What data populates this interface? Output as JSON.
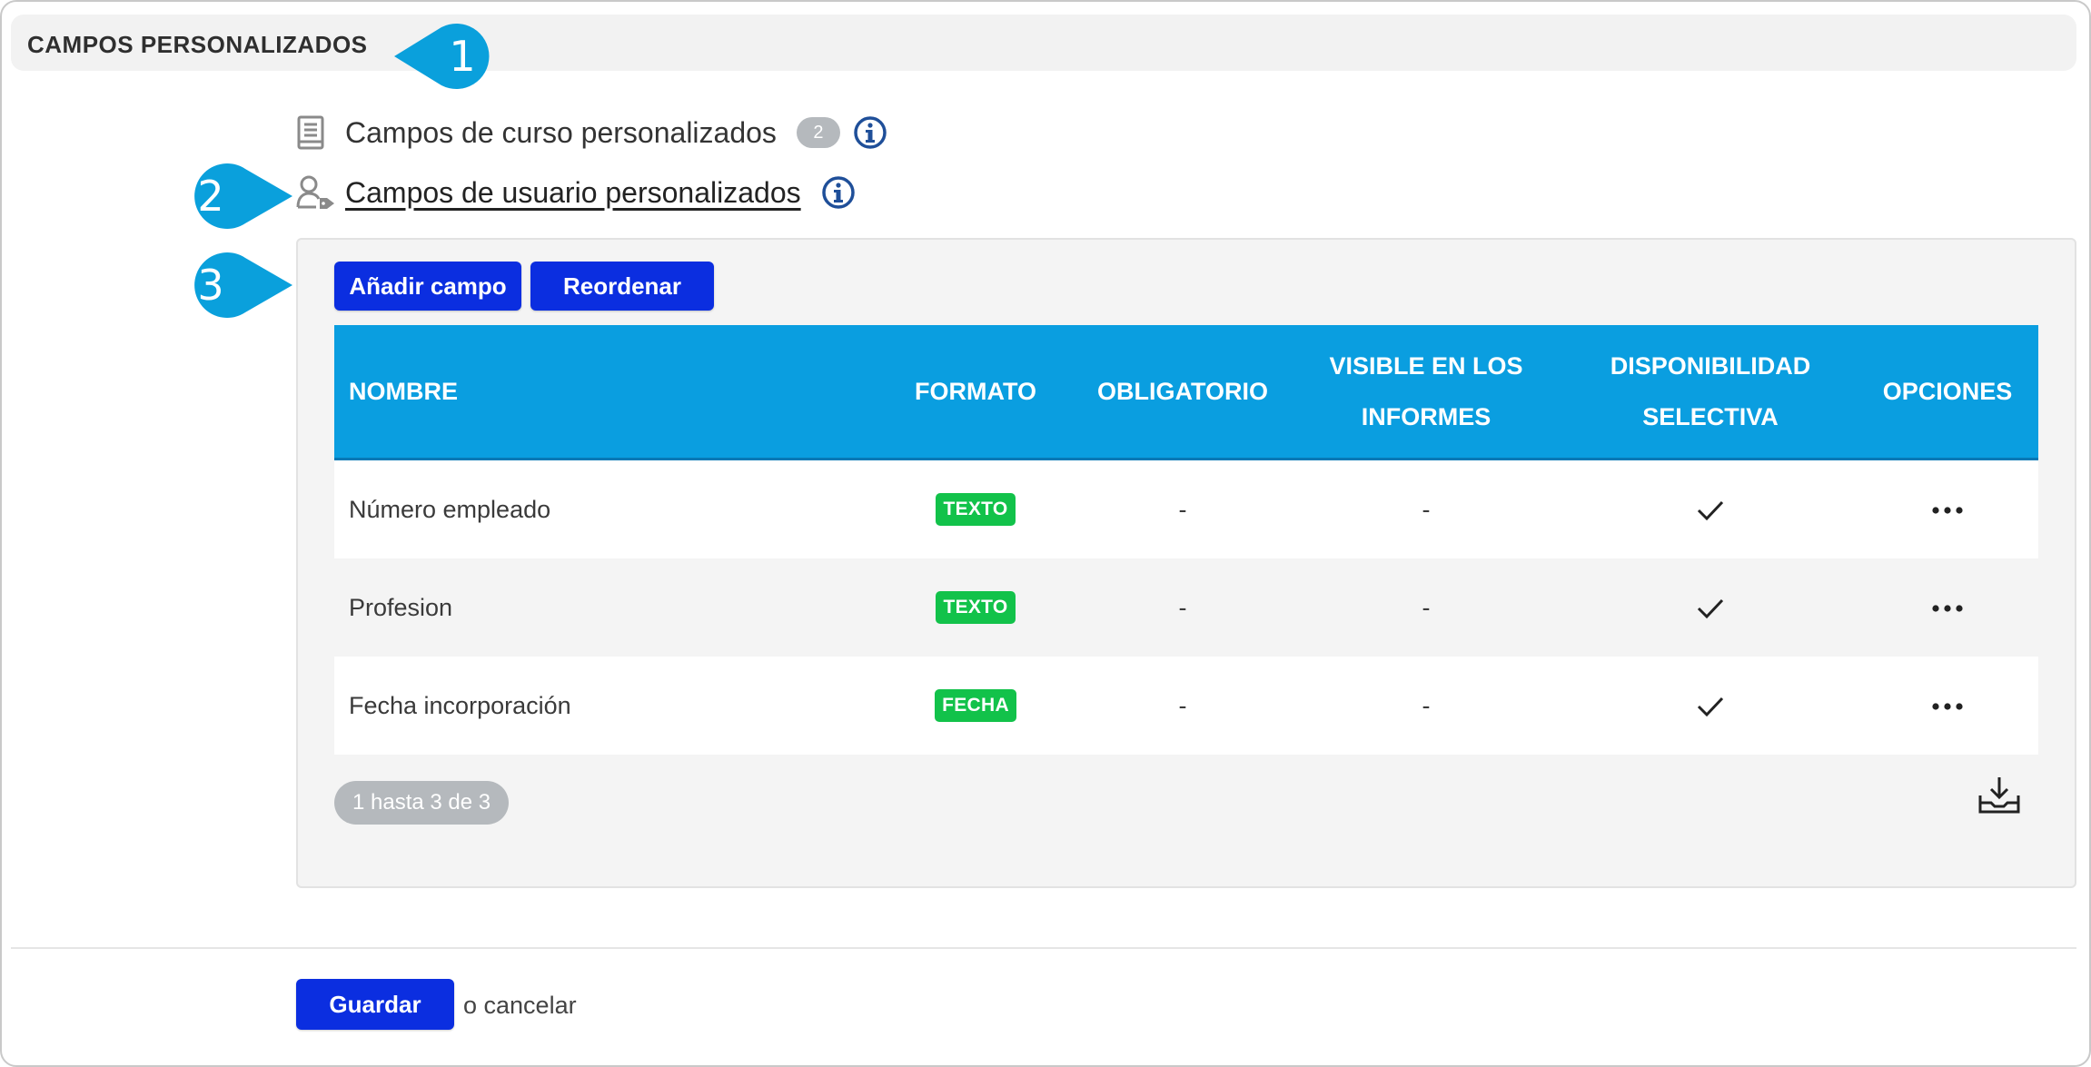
{
  "section": {
    "title": "CAMPOS PERSONALIZADOS"
  },
  "callouts": [
    "1",
    "2",
    "3"
  ],
  "links": {
    "course_fields": {
      "label": "Campos de curso personalizados",
      "count": "2",
      "icon": "book-icon"
    },
    "user_fields": {
      "label": "Campos de usuario personalizados",
      "icon": "user-tag-icon"
    }
  },
  "toolbar": {
    "add_label": "Añadir campo",
    "reorder_label": "Reordenar"
  },
  "table": {
    "headers": {
      "name": "NOMBRE",
      "format": "FORMATO",
      "required": "OBLIGATORIO",
      "visible_l1": "VISIBLE EN LOS",
      "visible_l2": "INFORMES",
      "availability_l1": "DISPONIBILIDAD",
      "availability_l2": "SELECTIVA",
      "options": "OPCIONES"
    },
    "rows": [
      {
        "name": "Número empleado",
        "format": "TEXTO",
        "required": "-",
        "visible": "-",
        "selective": true
      },
      {
        "name": "Profesion",
        "format": "TEXTO",
        "required": "-",
        "visible": "-",
        "selective": true
      },
      {
        "name": "Fecha incorporación",
        "format": "FECHA",
        "required": "-",
        "visible": "-",
        "selective": true
      }
    ]
  },
  "pager": {
    "label": "1 hasta 3 de 3"
  },
  "footer": {
    "save_label": "Guardar",
    "cancel_label": "o cancelar"
  },
  "colors": {
    "primary_button": "#0b2ee0",
    "table_header": "#0a9ee0",
    "callout": "#0aa0dc",
    "format_badge": "#12c24a",
    "info_icon": "#1f4f99"
  }
}
